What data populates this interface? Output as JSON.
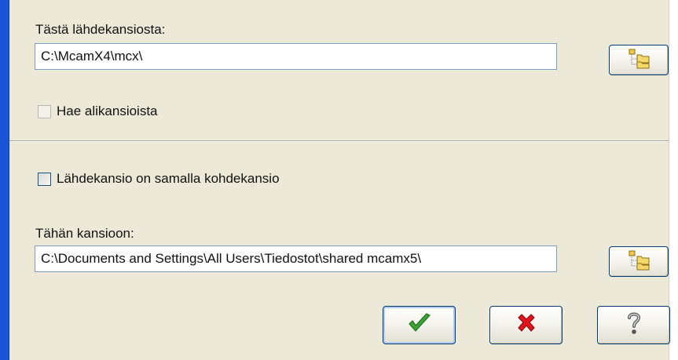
{
  "source": {
    "label": "Tästä lähdekansiosta:",
    "path": "C:\\McamX4\\mcx\\",
    "browse_icon": "folder-tree-icon"
  },
  "subfolders": {
    "label": "Hae alikansioista",
    "checked": false,
    "enabled": false
  },
  "same_folder": {
    "label": "Lähdekansio on samalla kohdekansio",
    "checked": false
  },
  "target": {
    "label": "Tähän kansioon:",
    "path": "C:\\Documents and Settings\\All Users\\Tiedostot\\shared mcamx5\\",
    "browse_icon": "folder-tree-icon"
  },
  "buttons": {
    "ok_icon": "green-checkmark-icon",
    "cancel_icon": "red-x-icon",
    "help_icon": "question-mark-icon"
  },
  "colors": {
    "dialog_bg": "#ece9d8",
    "ok_check": "#3ca236",
    "cancel_x": "#e0151b",
    "window_frame": "#1a55d8"
  }
}
